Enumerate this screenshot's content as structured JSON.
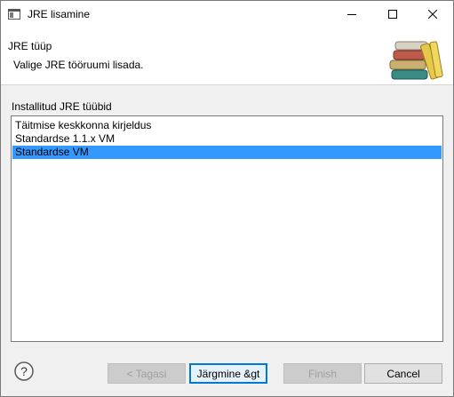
{
  "window": {
    "title": "JRE lisamine"
  },
  "banner": {
    "title": "JRE tüüp",
    "description": "Valige JRE tööruumi lisada."
  },
  "list": {
    "label": "Installitud JRE tüübid",
    "items": [
      "Täitmise keskkonna kirjeldus",
      "Standardse 1.1.x VM",
      "Standardse VM"
    ],
    "selected": "Standardse VM"
  },
  "buttons": {
    "back": "< Tagasi",
    "next": "Järgmine &gt",
    "finish": "Finish",
    "cancel": "Cancel"
  },
  "colors": {
    "selection": "#3399ff",
    "focus_border": "#0078d7"
  }
}
